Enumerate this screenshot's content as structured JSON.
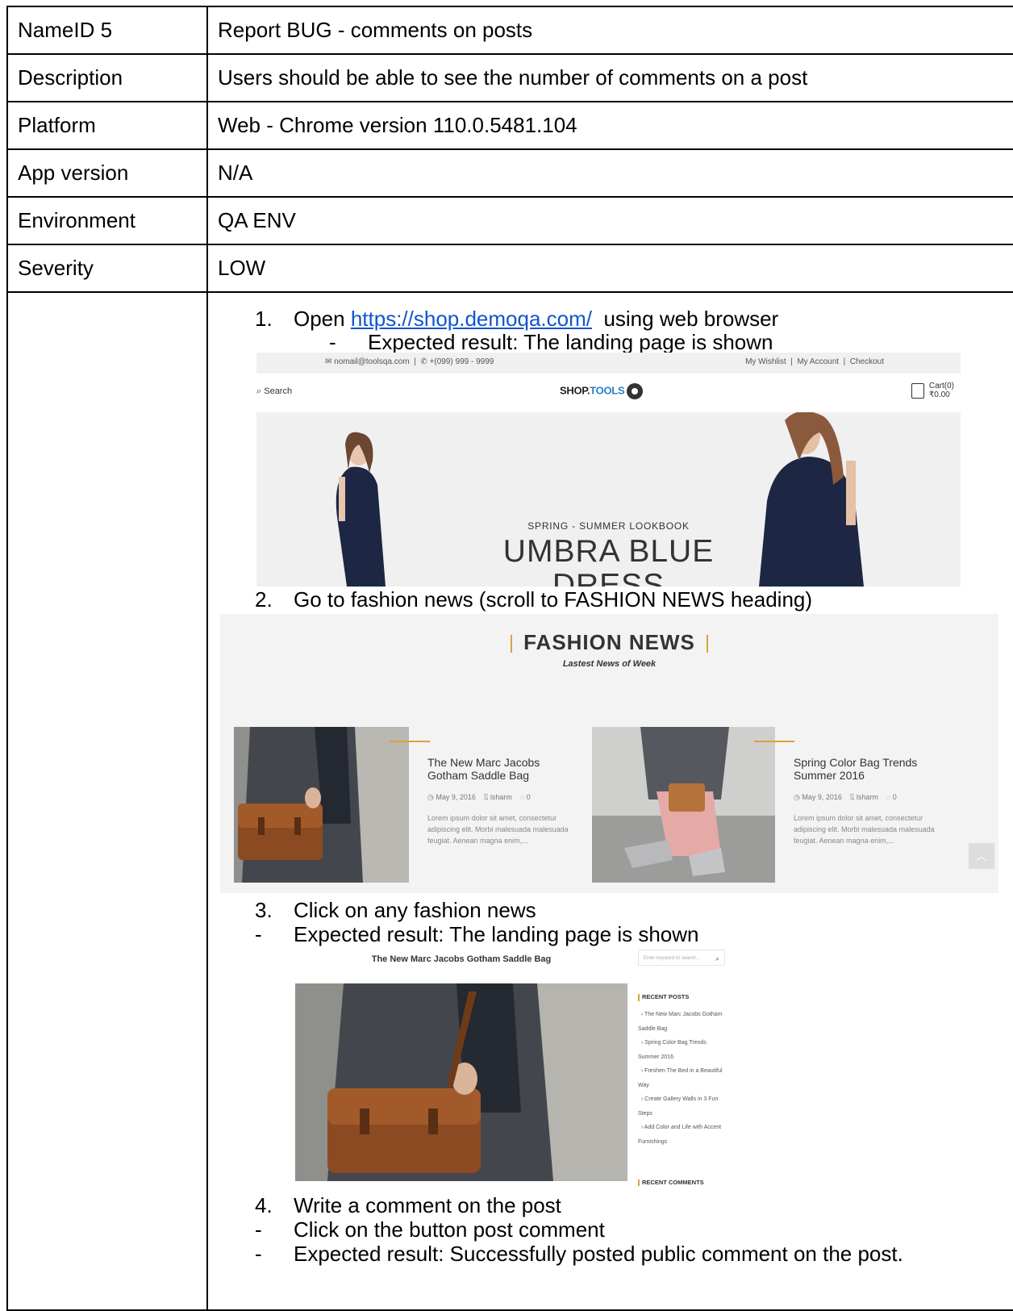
{
  "fields": [
    {
      "label": "NameID 5",
      "value": "Report BUG - comments on posts"
    },
    {
      "label": "Description",
      "value": "Users should be able to see the number of comments on a post"
    },
    {
      "label": "Platform",
      "value": "Web - Chrome version 110.0.5481.104"
    },
    {
      "label": "App version",
      "value": "N/A"
    },
    {
      "label": "Environment",
      "value": "QA ENV"
    },
    {
      "label": "Severity",
      "value": "LOW"
    }
  ],
  "steps": {
    "s1_num": "1.",
    "s1_pre": "Open ",
    "s1_link": "https://shop.demoqa.com/",
    "s1_post": "  using web browser",
    "s1_dash": "-",
    "s1_expected": "Expected result: The landing page is shown",
    "s2_num": "2.",
    "s2_text": "Go to fashion news (scroll to FASHION NEWS heading)",
    "s3_num": "3.",
    "s3_text": "Click on any fashion news",
    "s3_dash": "-",
    "s3_expected": "Expected result: The landing page is shown",
    "s4_num": "4.",
    "s4_text": "Write a comment on the post",
    "s4_dash1": "-",
    "s4_sub1": "Click on the button post comment",
    "s4_dash2": "-",
    "s4_sub2": "Expected result: Successfully posted public comment on the post."
  },
  "shot1": {
    "email": "nomail@toolsqa.com",
    "phone": "+(099) 999 - 9999",
    "links": "My Wishlist  |  My Account  |  Checkout",
    "search": "Search",
    "logo_shop": "SHOP.",
    "logo_tools": "TOOLS",
    "cart": "Cart(0)",
    "cart_total": "₹0.00",
    "hero_sub": "SPRING - SUMMER LOOKBOOK",
    "hero_title": "UMBRA BLUE",
    "hero_title2": "DRESS"
  },
  "shot2": {
    "title": "FASHION NEWS",
    "subtitle": "Lastest News of Week",
    "posts": [
      {
        "title": "The New Marc Jacobs Gotham Saddle Bag",
        "date": "May 9, 2016",
        "author": "lsharm",
        "comments": "0",
        "excerpt": "Lorem ipsum dolor sit amet, consectetur adipiscing elit. Morbi malesuada malesuada feugiat. Aenean magna enim,..."
      },
      {
        "title": "Spring Color Bag Trends Summer 2016",
        "date": "May 9, 2016",
        "author": "lsharm",
        "comments": "0",
        "excerpt": "Lorem ipsum dolor sit amet, consectetur adipiscing elit. Morbi malesuada malesuada feugiat. Aenean magna enim,..."
      }
    ]
  },
  "shot3": {
    "title": "The New Marc Jacobs Gotham Saddle Bag",
    "search_placeholder": "Enter keyword to search...",
    "recent_posts": "RECENT POSTS",
    "items": [
      "The New Marc Jacobs Gotham Saddle Bag",
      "Spring Color Bag Trends Summer 2016",
      "Freshen The Bed in a Beautiful Way",
      "Create Gallery Walls in 3 Fun Steps",
      "Add Color and Life with Accent Furnishings"
    ],
    "recent_comments": "RECENT COMMENTS"
  },
  "colors": {
    "link": "#1155cc",
    "accent": "#d4a63a",
    "tools_blue": "#2a7fc6"
  }
}
